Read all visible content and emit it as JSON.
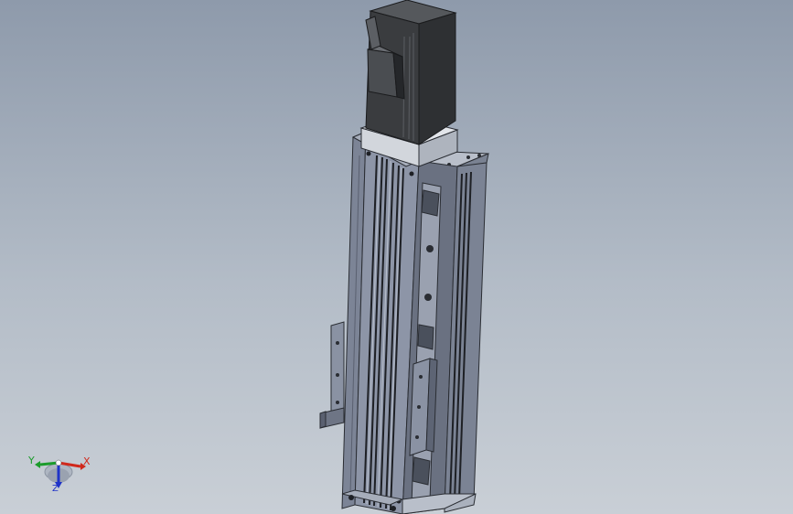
{
  "viewport": {
    "background_top": "#8e9aab",
    "background_bottom": "#c9cfd6"
  },
  "model": {
    "icon": "linear-actuator-icon",
    "body_color": "#7f8798",
    "motor_color": "#3b3d3f",
    "flange_color": "#c8ccd2"
  },
  "triad": {
    "icon": "coordinate-triad-icon",
    "x_label": "X",
    "y_label": "Y",
    "z_label": "Z",
    "x_color": "#d0291c",
    "y_color": "#1c9c2c",
    "z_color": "#1f33c8"
  }
}
